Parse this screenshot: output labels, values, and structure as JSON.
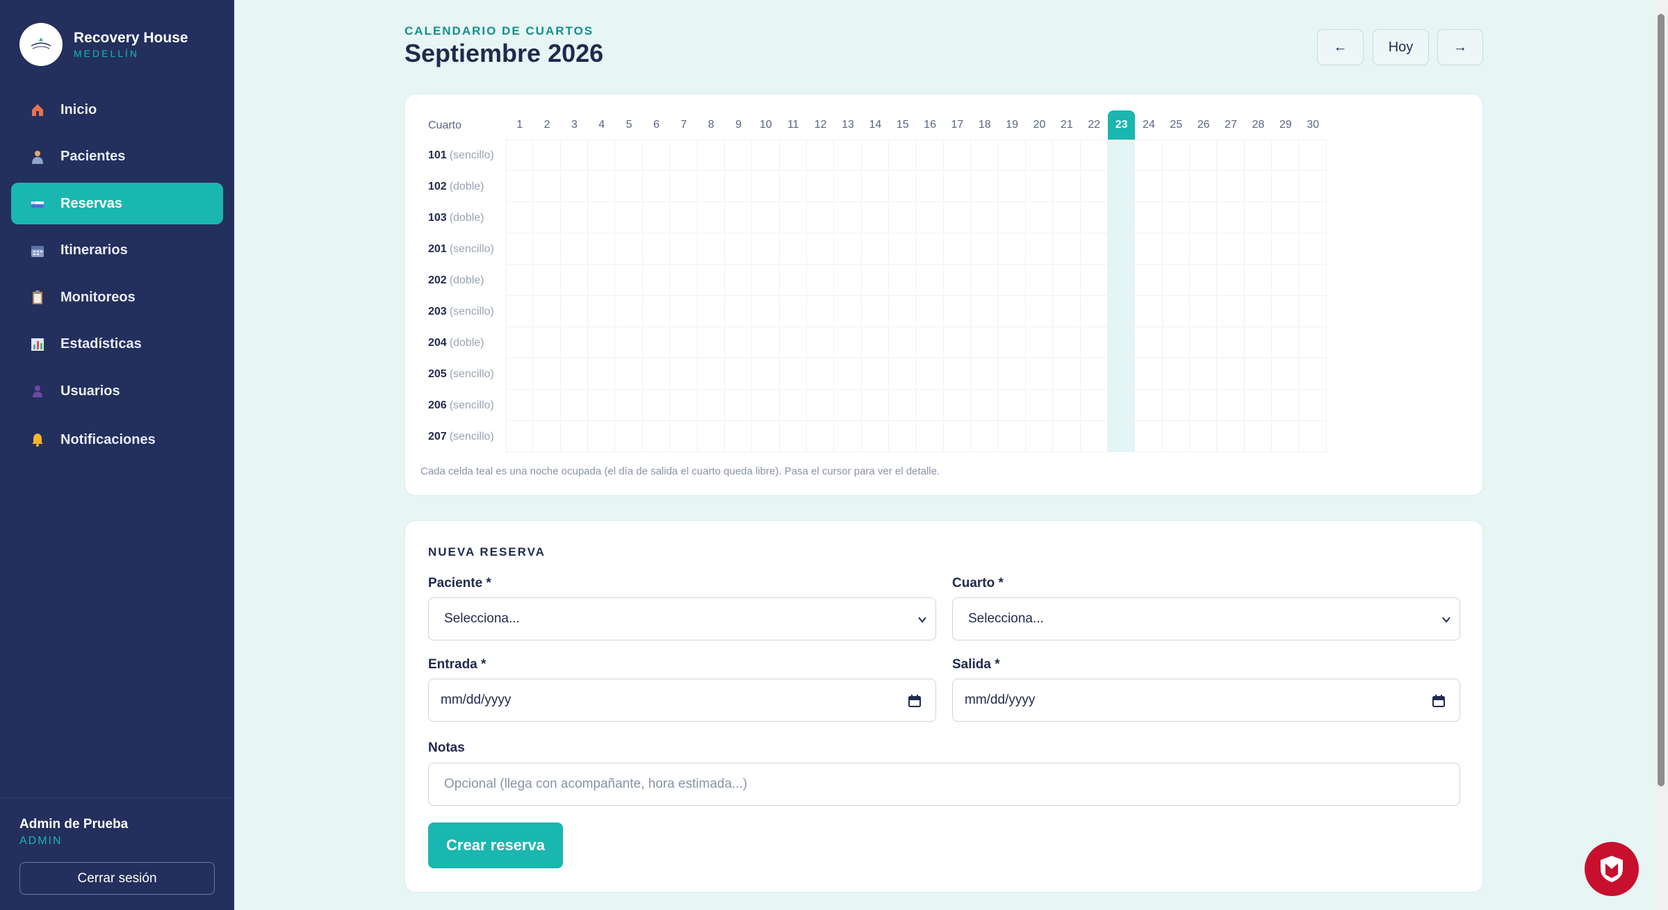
{
  "brand": {
    "name": "Recovery House",
    "city": "MEDELLÍN"
  },
  "nav": [
    {
      "id": "inicio",
      "label": "Inicio",
      "icon": "house-icon",
      "color": "#e8734a"
    },
    {
      "id": "pacientes",
      "label": "Pacientes",
      "icon": "person-icon",
      "color": "#e0a96d"
    },
    {
      "id": "reservas",
      "label": "Reservas",
      "icon": "bed-icon",
      "color": "#ffffff",
      "active": true
    },
    {
      "id": "itinerarios",
      "label": "Itinerarios",
      "icon": "calendar-icon",
      "color": "#8c9fc6"
    },
    {
      "id": "monitoreos",
      "label": "Monitoreos",
      "icon": "clipboard-icon",
      "color": "#b68a5e"
    },
    {
      "id": "estadisticas",
      "label": "Estadísticas",
      "icon": "bar-chart-icon",
      "color": "#5aa0d8"
    },
    {
      "id": "usuarios",
      "label": "Usuarios",
      "icon": "user-silhouette-icon",
      "color": "#6b4aa0"
    },
    {
      "id": "notificaciones",
      "label": "Notificaciones",
      "icon": "bell-icon",
      "color": "#f2b630"
    }
  ],
  "user": {
    "name": "Admin de Prueba",
    "role": "ADMIN",
    "logout_label": "Cerrar sesión"
  },
  "header": {
    "kicker": "CALENDARIO DE CUARTOS",
    "title": "Septiembre 2026",
    "prev_label": "←",
    "today_label": "Hoy",
    "next_label": "→"
  },
  "calendar": {
    "room_header": "Cuarto",
    "days": [
      "1",
      "2",
      "3",
      "4",
      "5",
      "6",
      "7",
      "8",
      "9",
      "10",
      "11",
      "12",
      "13",
      "14",
      "15",
      "16",
      "17",
      "18",
      "19",
      "20",
      "21",
      "22",
      "23",
      "24",
      "25",
      "26",
      "27",
      "28",
      "29",
      "30"
    ],
    "today": "23",
    "rooms": [
      {
        "number": "101",
        "type": "(sencillo)"
      },
      {
        "number": "102",
        "type": "(doble)"
      },
      {
        "number": "103",
        "type": "(doble)"
      },
      {
        "number": "201",
        "type": "(sencillo)"
      },
      {
        "number": "202",
        "type": "(doble)"
      },
      {
        "number": "203",
        "type": "(sencillo)"
      },
      {
        "number": "204",
        "type": "(doble)"
      },
      {
        "number": "205",
        "type": "(sencillo)"
      },
      {
        "number": "206",
        "type": "(sencillo)"
      },
      {
        "number": "207",
        "type": "(sencillo)"
      }
    ],
    "note": "Cada celda teal es una noche ocupada (el día de salida el cuarto queda libre). Pasa el cursor para ver el detalle."
  },
  "form": {
    "title": "NUEVA RESERVA",
    "patient_label": "Paciente *",
    "patient_value": "Selecciona...",
    "room_label": "Cuarto *",
    "room_value": "Selecciona...",
    "checkin_label": "Entrada *",
    "checkin_value": "mm/dd/yyyy",
    "checkout_label": "Salida *",
    "checkout_value": "mm/dd/yyyy",
    "notes_label": "Notas",
    "notes_placeholder": "Opcional (llega con acompañante, hora estimada...)",
    "submit_label": "Crear reserva"
  },
  "colors": {
    "sidebar": "#232f5c",
    "accent": "#19b7b0",
    "background": "#e7f5f5",
    "shield": "#c8102e"
  }
}
